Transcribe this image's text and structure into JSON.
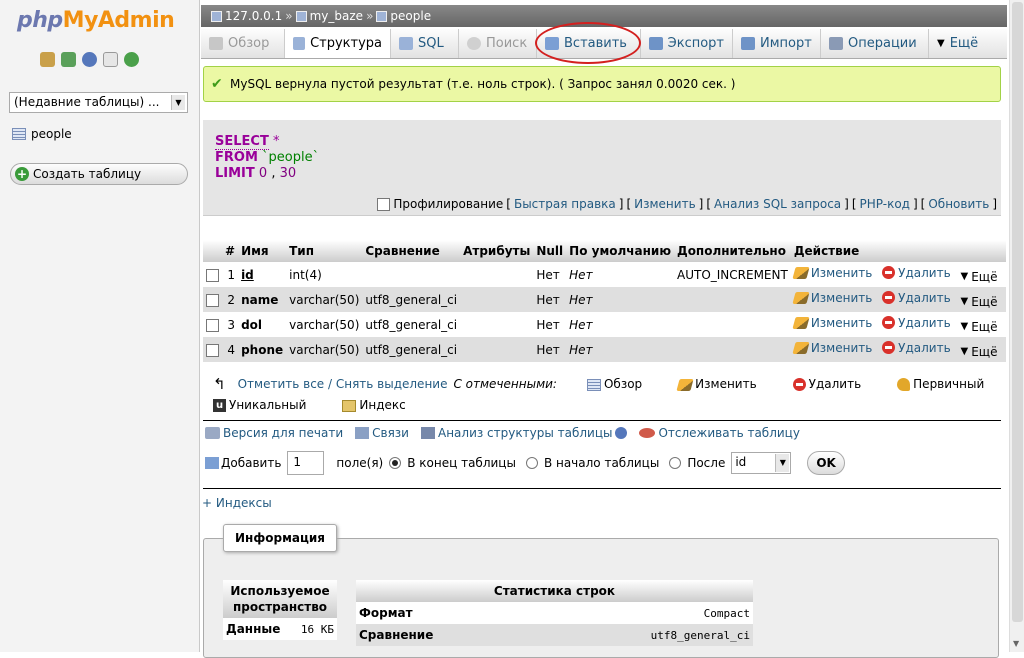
{
  "logo": {
    "php": "php",
    "my": "My",
    "admin": "Admin"
  },
  "left": {
    "recent_select": "(Недавние таблицы) ...",
    "tables": [
      {
        "name": "people"
      }
    ],
    "create_table": "Создать таблицу"
  },
  "breadcrumb": {
    "server": "127.0.0.1",
    "sep1": "»",
    "db": "my_baze",
    "sep2": "»",
    "table": "people"
  },
  "tabs": [
    {
      "label": "Обзор",
      "state": "disabled",
      "icon": "browse-icon"
    },
    {
      "label": "Структура",
      "state": "active",
      "icon": "structure-icon"
    },
    {
      "label": "SQL",
      "state": "normal",
      "icon": "sql-icon"
    },
    {
      "label": "Поиск",
      "state": "disabled",
      "icon": "search-icon"
    },
    {
      "label": "Вставить",
      "state": "normal",
      "icon": "insert-icon"
    },
    {
      "label": "Экспорт",
      "state": "normal",
      "icon": "export-icon"
    },
    {
      "label": "Импорт",
      "state": "normal",
      "icon": "import-icon"
    },
    {
      "label": "Операции",
      "state": "normal",
      "icon": "wrench-icon"
    },
    {
      "label": "Ещё",
      "state": "normal",
      "icon": "triangle-down-icon"
    }
  ],
  "message": "MySQL вернула пустой результат (т.е. ноль строк). ( Запрос занял 0.0020 сек. )",
  "sql": {
    "select": "SELECT",
    "star": "*",
    "from": "FROM",
    "table": "`people`",
    "limit": "LIMIT",
    "offset": "0",
    "comma": ",",
    "count": "30"
  },
  "sql_links": {
    "profiling": "Профилирование",
    "lb1": "[",
    "quick_edit": "Быстрая правка",
    "rb1": "]",
    "lb2": "[",
    "edit": "Изменить",
    "rb2": "]",
    "lb3": "[",
    "explain": "Анализ SQL запроса",
    "rb3": "]",
    "lb4": "[",
    "php": "PHP-код",
    "rb4": "]",
    "lb5": "[",
    "refresh": "Обновить",
    "rb5": "]"
  },
  "structure": {
    "headers": [
      "#",
      "Имя",
      "Тип",
      "Сравнение",
      "Атрибуты",
      "Null",
      "По умолчанию",
      "Дополнительно",
      "Действие"
    ],
    "rows": [
      {
        "num": "1",
        "name": "id",
        "type": "int(4)",
        "collation": "",
        "attributes": "",
        "null": "Нет",
        "default": "Нет",
        "extra": "AUTO_INCREMENT"
      },
      {
        "num": "2",
        "name": "name",
        "type": "varchar(50)",
        "collation": "utf8_general_ci",
        "attributes": "",
        "null": "Нет",
        "default": "Нет",
        "extra": ""
      },
      {
        "num": "3",
        "name": "dol",
        "type": "varchar(50)",
        "collation": "utf8_general_ci",
        "attributes": "",
        "null": "Нет",
        "default": "Нет",
        "extra": ""
      },
      {
        "num": "4",
        "name": "phone",
        "type": "varchar(50)",
        "collation": "utf8_general_ci",
        "attributes": "",
        "null": "Нет",
        "default": "Нет",
        "extra": ""
      }
    ],
    "actions": {
      "edit": "Изменить",
      "delete": "Удалить",
      "more": "Ещё"
    }
  },
  "with_selected": {
    "check_all": "Отметить все / Снять выделение",
    "label": "С отмеченными:",
    "browse": "Обзор",
    "edit": "Изменить",
    "delete": "Удалить",
    "primary": "Первичный",
    "unique": "Уникальный",
    "index": "Индекс"
  },
  "tools": {
    "print": "Версия для печати",
    "relations": "Связи",
    "analyze": "Анализ структуры таблицы",
    "track": "Отслеживать таблицу"
  },
  "add_field": {
    "add": "Добавить",
    "count": "1",
    "fields": "поле(я)",
    "at_end": "В конец таблицы",
    "at_begin": "В начало таблицы",
    "after": "После",
    "after_field": "id",
    "ok": "OK"
  },
  "indexes_link": "+ Индексы",
  "info": {
    "legend": "Информация",
    "space_header": "Используемое пространство",
    "space_rows": [
      {
        "label": "Данные",
        "value": "16",
        "unit": "КБ"
      }
    ],
    "stats_header": "Статистика строк",
    "stats_rows": [
      {
        "label": "Формат",
        "value": "Compact"
      },
      {
        "label": "Сравнение",
        "value": "utf8_general_ci"
      }
    ]
  },
  "colors": {
    "link": "#235a81",
    "success_bg": "#ebf8a4",
    "highlight_circle": "#d3201f",
    "logo_orange": "#f29111",
    "logo_blue": "#6c78af"
  }
}
